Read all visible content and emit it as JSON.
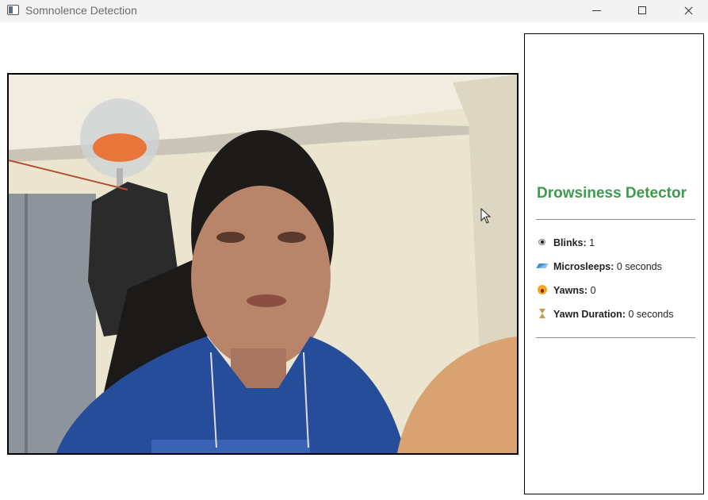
{
  "window": {
    "title": "Somnolence Detection",
    "controls": [
      "minimize",
      "maximize",
      "close"
    ]
  },
  "video": {
    "description_icon": "webcam-feed"
  },
  "panel": {
    "title": "Drowsiness Detector",
    "title_color": "#3c9b4c",
    "stats": [
      {
        "icon": "eye-icon",
        "label": "Blinks:",
        "value": "1"
      },
      {
        "icon": "zzz-icon",
        "label": "Microsleeps:",
        "value": "0 seconds"
      },
      {
        "icon": "yawn-face-icon",
        "label": "Yawns:",
        "value": "0"
      },
      {
        "icon": "hourglass-icon",
        "label": "Yawn Duration:",
        "value": "0 seconds"
      }
    ]
  }
}
